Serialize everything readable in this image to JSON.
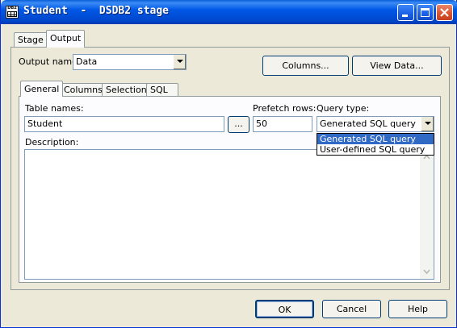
{
  "window": {
    "title": "Student  -  DSDB2 stage",
    "icon_text": "DB2"
  },
  "outer_tabs": [
    {
      "label": "Stage",
      "active": false
    },
    {
      "label": "Output",
      "active": true
    }
  ],
  "output_name": {
    "label": "Output name:",
    "value": "Data"
  },
  "columns_button": "Columns...",
  "view_data_button": "View Data...",
  "inner_tabs": [
    {
      "label": "General",
      "active": true
    },
    {
      "label": "Columns",
      "active": false
    },
    {
      "label": "Selection",
      "active": false
    },
    {
      "label": "SQL",
      "active": false
    }
  ],
  "table_names": {
    "label": "Table names:",
    "value": "Student",
    "browse": "..."
  },
  "prefetch_rows": {
    "label": "Prefetch rows:",
    "value": "50"
  },
  "query_type": {
    "label": "Query type:",
    "value": "Generated SQL query",
    "options": [
      "Generated SQL query",
      "User-defined SQL query"
    ],
    "highlighted": "Generated SQL query"
  },
  "description": {
    "label": "Description:",
    "value": ""
  },
  "footer": {
    "ok": "OK",
    "cancel": "Cancel",
    "help": "Help"
  },
  "colors": {
    "titlebar": "#0058e6",
    "highlight": "#316ac5",
    "dialog_bg": "#ece9d8"
  }
}
